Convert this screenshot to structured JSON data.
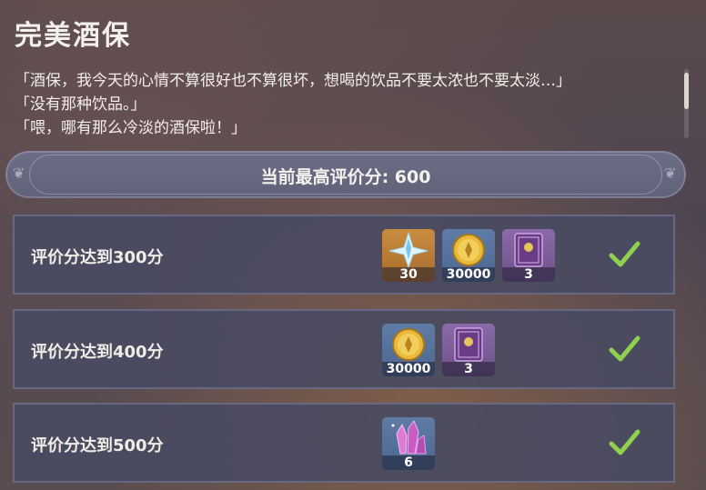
{
  "page": {
    "title": "完美酒保",
    "dialog": [
      "「酒保，我今天的心情不算很好也不算很坏，想喝的饮品不要太浓也不要太淡…」",
      "「没有那种饮品。」",
      "「喂，哪有那么冷淡的酒保啦！」"
    ]
  },
  "best_score": {
    "label": "当前最高评价分: 600"
  },
  "tiers": [
    {
      "label": "评价分达到300分",
      "completed": true,
      "rewards": [
        {
          "icon": "primogem-icon",
          "count": "30"
        },
        {
          "icon": "mora-icon",
          "count": "30000"
        },
        {
          "icon": "heros-wit-icon",
          "count": "3"
        }
      ]
    },
    {
      "label": "评价分达到400分",
      "completed": true,
      "rewards": [
        {
          "icon": "mora-icon",
          "count": "30000"
        },
        {
          "icon": "heros-wit-icon",
          "count": "3"
        }
      ]
    },
    {
      "label": "评价分达到500分",
      "completed": true,
      "rewards": [
        {
          "icon": "crystal-ore-icon",
          "count": "6"
        }
      ]
    }
  ],
  "colors": {
    "check": "#8fd14f",
    "panel": "#484a62"
  }
}
